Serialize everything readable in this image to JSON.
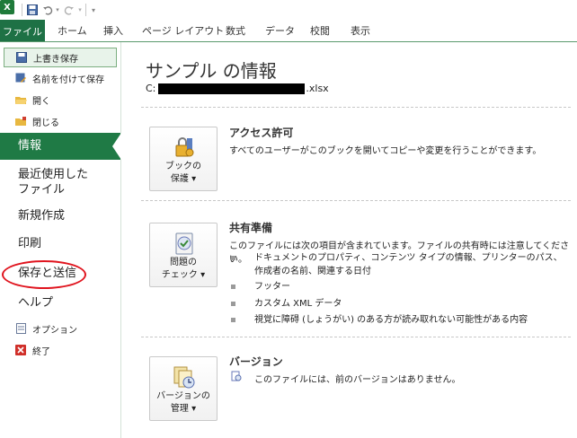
{
  "quick_access": {
    "app_icon": "excel-logo-icon",
    "logo_letter": "X"
  },
  "tabs": [
    {
      "label": "ファイル",
      "active": true
    },
    {
      "label": "ホーム"
    },
    {
      "label": "挿入"
    },
    {
      "label": "ページ レイアウト"
    },
    {
      "label": "数式"
    },
    {
      "label": "データ"
    },
    {
      "label": "校閲"
    },
    {
      "label": "表示"
    }
  ],
  "nav": {
    "save": "上書き保存",
    "save_as": "名前を付けて保存",
    "open": "開く",
    "close": "閉じる",
    "info": "情報",
    "recent": "最近使用したファイル",
    "recent_line1": "最近使用した",
    "recent_line2": "ファイル",
    "new": "新規作成",
    "print": "印刷",
    "save_send": "保存と送信",
    "help": "ヘルプ",
    "options": "オプション",
    "exit": "終了"
  },
  "main": {
    "title": "サンプル の情報",
    "path_prefix": "C:",
    "path_suffix": ".xlsx",
    "permissions": {
      "button_line1": "ブックの",
      "button_line2": "保護 ▾",
      "title": "アクセス許可",
      "desc": "すべてのユーザーがこのブックを開いてコピーや変更を行うことができます。"
    },
    "prepare": {
      "button_line1": "問題の",
      "button_line2": "チェック ▾",
      "title": "共有準備",
      "desc": "このファイルには次の項目が含まれています。ファイルの共有時には注意してください。",
      "items": [
        "ドキュメントのプロパティ、コンテンツ タイプの情報、プリンターのパス、作成者の名前、関連する日付",
        "フッター",
        "カスタム XML データ",
        "視覚に障碍 (しょうがい) のある方が読み取れない可能性がある内容"
      ]
    },
    "versions": {
      "button_line1": "バージョンの",
      "button_line2": "管理 ▾",
      "title": "バージョン",
      "desc": "このファイルには、前のバージョンはありません。"
    }
  },
  "colors": {
    "file_tab": "#1e7145",
    "info_selected": "#1f7a45",
    "highlight_circle": "#e0141e"
  }
}
